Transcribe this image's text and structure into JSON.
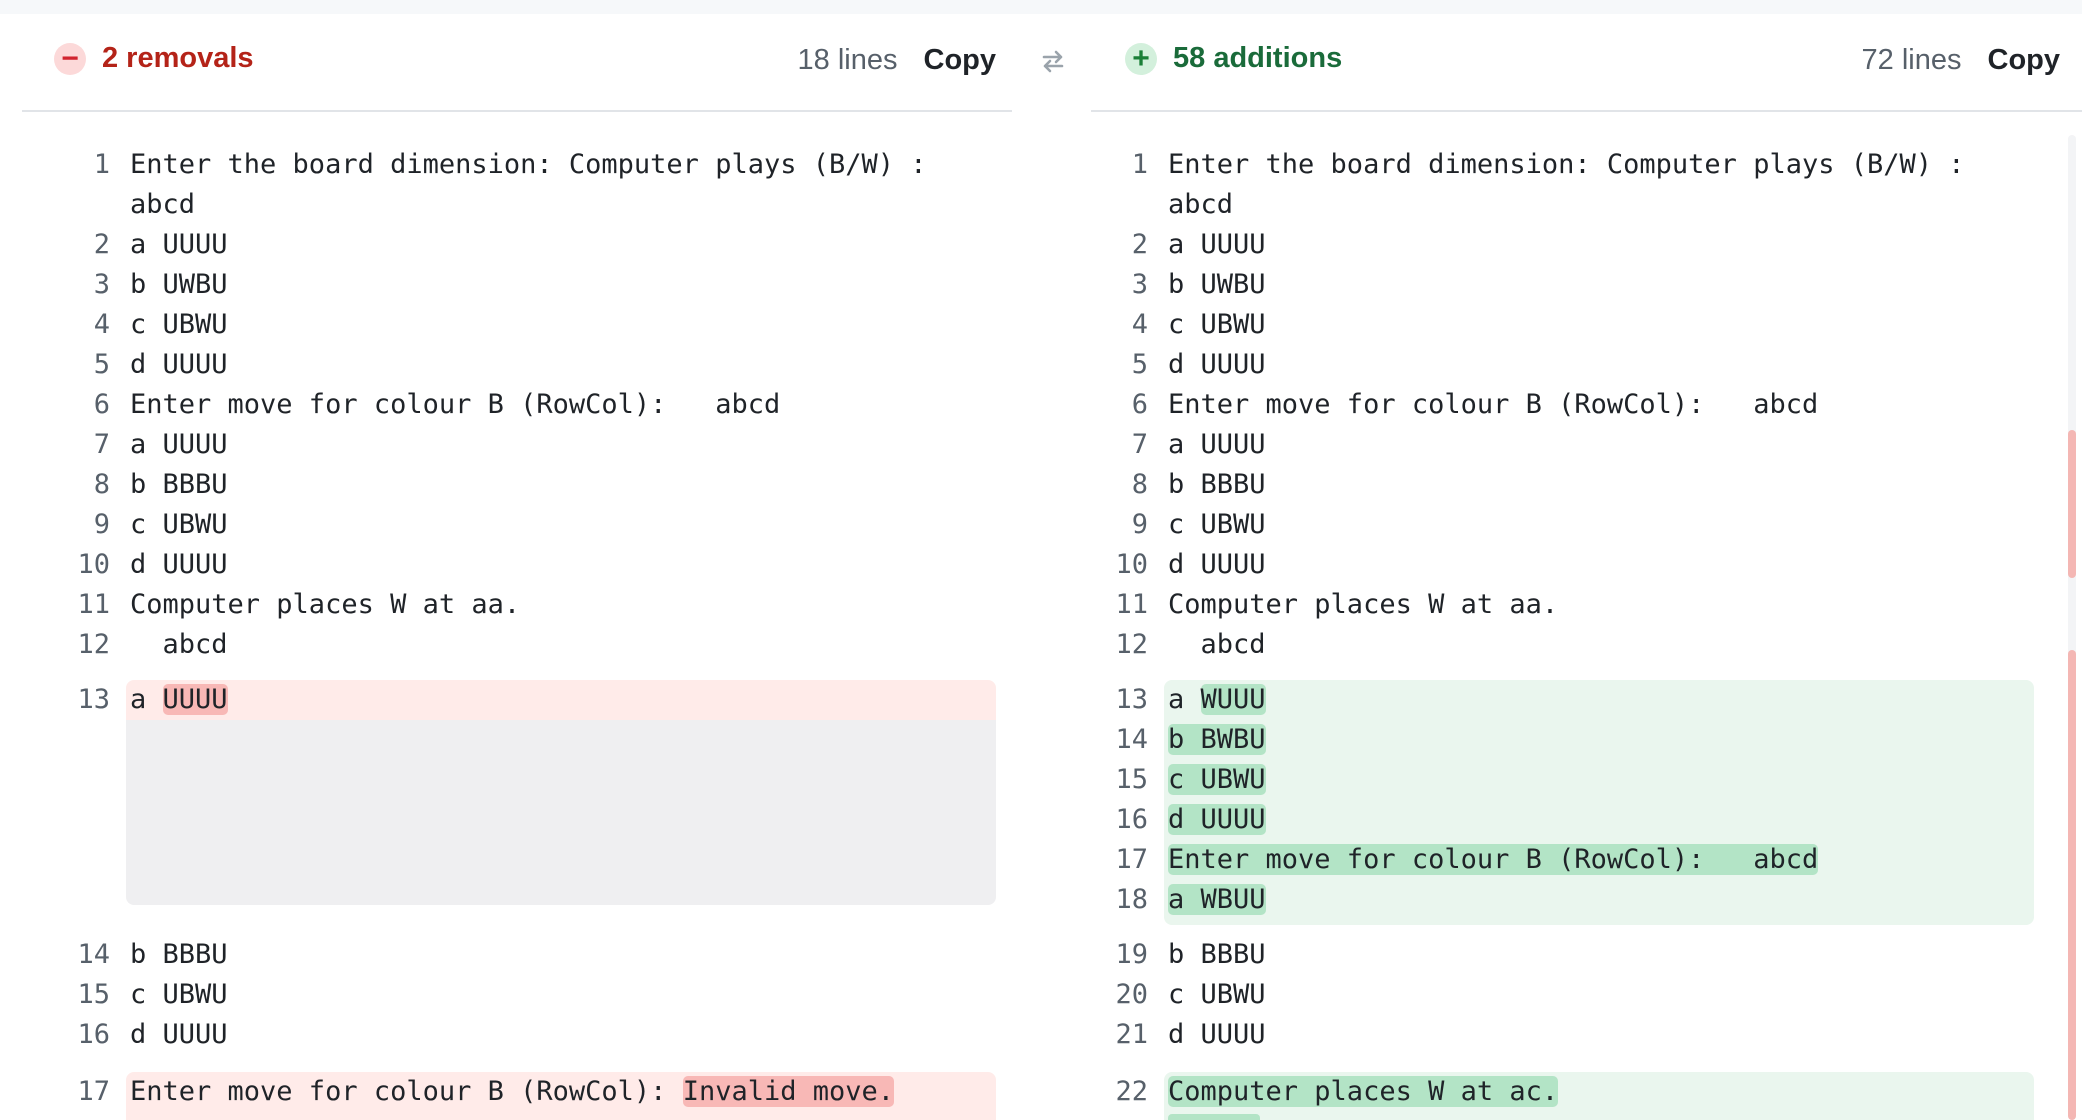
{
  "left_header": {
    "status_icon": "minus-icon",
    "status_label": "2 removals",
    "line_count": "18 lines",
    "copy_label": "Copy",
    "status_color": "#b42318"
  },
  "right_header": {
    "status_icon": "plus-icon",
    "status_label": "58 additions",
    "line_count": "72 lines",
    "copy_label": "Copy",
    "status_color": "#1a6b3a"
  },
  "swap_icon": "swap-arrows-icon",
  "left_lines": [
    {
      "n": "1",
      "text": "Enter the board dimension: Computer plays (B/W) :"
    },
    {
      "n": "",
      "text": "abcd"
    },
    {
      "n": "2",
      "text": "a UUUU"
    },
    {
      "n": "3",
      "text": "b UWBU"
    },
    {
      "n": "4",
      "text": "c UBWU"
    },
    {
      "n": "5",
      "text": "d UUUU"
    },
    {
      "n": "6",
      "text": "Enter move for colour B (RowCol):   abcd"
    },
    {
      "n": "7",
      "text": "a UUUU"
    },
    {
      "n": "8",
      "text": "b BBBU"
    },
    {
      "n": "9",
      "text": "c UBWU"
    },
    {
      "n": "10",
      "text": "d UUUU"
    },
    {
      "n": "11",
      "text": "Computer places W at aa."
    },
    {
      "n": "12",
      "text": "  abcd"
    },
    {
      "n": "13",
      "prefix": "a ",
      "hl": "UUUU"
    },
    {
      "n": "14",
      "text": "b BBBU"
    },
    {
      "n": "15",
      "text": "c UBWU"
    },
    {
      "n": "16",
      "text": "d UUUU"
    },
    {
      "n": "17",
      "prefix": "Enter move for colour B (RowCol): ",
      "hl": "Invalid move."
    }
  ],
  "right_lines": [
    {
      "n": "1",
      "text": "Enter the board dimension: Computer plays (B/W) :"
    },
    {
      "n": "",
      "text": "abcd"
    },
    {
      "n": "2",
      "text": "a UUUU"
    },
    {
      "n": "3",
      "text": "b UWBU"
    },
    {
      "n": "4",
      "text": "c UBWU"
    },
    {
      "n": "5",
      "text": "d UUUU"
    },
    {
      "n": "6",
      "text": "Enter move for colour B (RowCol):   abcd"
    },
    {
      "n": "7",
      "text": "a UUUU"
    },
    {
      "n": "8",
      "text": "b BBBU"
    },
    {
      "n": "9",
      "text": "c UBWU"
    },
    {
      "n": "10",
      "text": "d UUUU"
    },
    {
      "n": "11",
      "text": "Computer places W at aa."
    },
    {
      "n": "12",
      "text": "  abcd"
    },
    {
      "n": "13",
      "prefix": "a ",
      "hl": "WUUU"
    },
    {
      "n": "14",
      "hl": "b BWBU"
    },
    {
      "n": "15",
      "hl": "c UBWU"
    },
    {
      "n": "16",
      "hl": "d UUUU"
    },
    {
      "n": "17",
      "hl": "Enter move for colour B (RowCol):   abcd"
    },
    {
      "n": "18",
      "hl": "a WBUU"
    },
    {
      "n": "19",
      "text": "b BBBU"
    },
    {
      "n": "20",
      "text": "c UBWU"
    },
    {
      "n": "21",
      "text": "d UUUU"
    },
    {
      "n": "22",
      "hl": "Computer places W at ac."
    }
  ]
}
